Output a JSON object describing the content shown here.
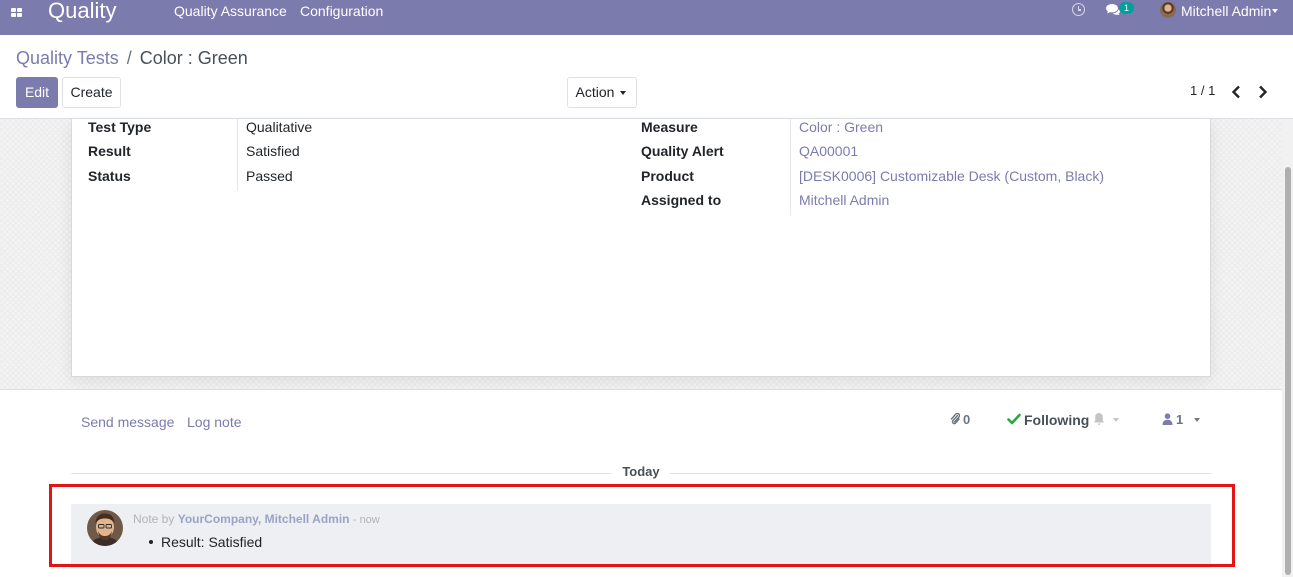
{
  "navbar": {
    "app_name": "Quality",
    "menus": [
      "Quality Assurance",
      "Configuration"
    ],
    "chat_badge": "1",
    "user_name": "Mitchell Admin",
    "icons": [
      "apps-icon",
      "clock-icon",
      "chat-icon",
      "user-avatar"
    ]
  },
  "breadcrumb": {
    "parent": "Quality Tests",
    "separator": "/",
    "current": "Color : Green"
  },
  "buttons": {
    "edit": "Edit",
    "create": "Create",
    "action": "Action"
  },
  "pager": {
    "value": "1 / 1"
  },
  "form": {
    "left_fields": [
      {
        "label": "Test Type",
        "value": "Qualitative"
      },
      {
        "label": "Result",
        "value": "Satisfied"
      },
      {
        "label": "Status",
        "value": "Passed"
      }
    ],
    "right_fields": [
      {
        "label": "Measure",
        "value": "Color : Green"
      },
      {
        "label": "Quality Alert",
        "value": "QA00001"
      },
      {
        "label": "Product",
        "value": "[DESK0006] Customizable Desk (Custom, Black)"
      },
      {
        "label": "Assigned to",
        "value": "Mitchell Admin"
      }
    ]
  },
  "chatter": {
    "send_message": "Send message",
    "log_note": "Log note",
    "attachments_count": "0",
    "following": "Following",
    "followers_count": "1",
    "date_separator": "Today",
    "message": {
      "prefix": "Note by",
      "author": "YourCompany, Mitchell Admin",
      "time": "- now",
      "body": "Result: Satisfied"
    }
  },
  "colors": {
    "brand": "#7c7bad",
    "link": "#7c7bad",
    "success": "#28a745",
    "highlight": "#e41414",
    "badge": "#00a09d"
  }
}
